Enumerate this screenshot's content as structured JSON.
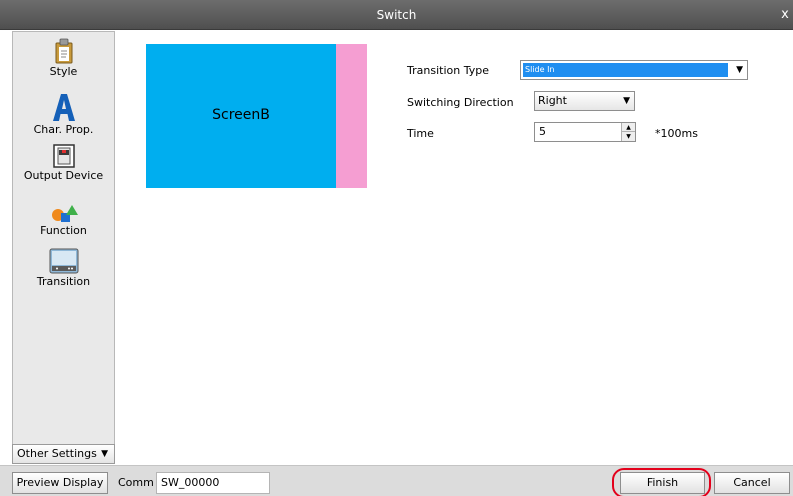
{
  "window": {
    "title": "Switch",
    "close_glyph": "x"
  },
  "sidebar": {
    "items": [
      {
        "label": "Style",
        "icon": "clipboard-icon"
      },
      {
        "label": "Char. Prop.",
        "icon": "letter-a-icon"
      },
      {
        "label": "Output Device",
        "icon": "switch-device-icon"
      },
      {
        "label": "Function",
        "icon": "shapes-icon"
      },
      {
        "label": "Transition",
        "icon": "transition-screen-icon",
        "selected": true
      }
    ],
    "other_settings_label": "Other Settings"
  },
  "preview": {
    "screen_label": "ScreenB",
    "colors": {
      "screen": "#00aeef",
      "incoming": "#f59ed2"
    }
  },
  "form": {
    "transition_type": {
      "label": "Transition Type",
      "value": "Slide In"
    },
    "switching_direction": {
      "label": "Switching Direction",
      "value": "Right"
    },
    "time": {
      "label": "Time",
      "value": "5",
      "unit": "*100ms"
    }
  },
  "footer": {
    "preview_button": "Preview Display",
    "comm_label": "Comm",
    "comm_value": "SW_00000",
    "finish_button": "Finish",
    "cancel_button": "Cancel",
    "highlight_color": "#e3001b"
  }
}
